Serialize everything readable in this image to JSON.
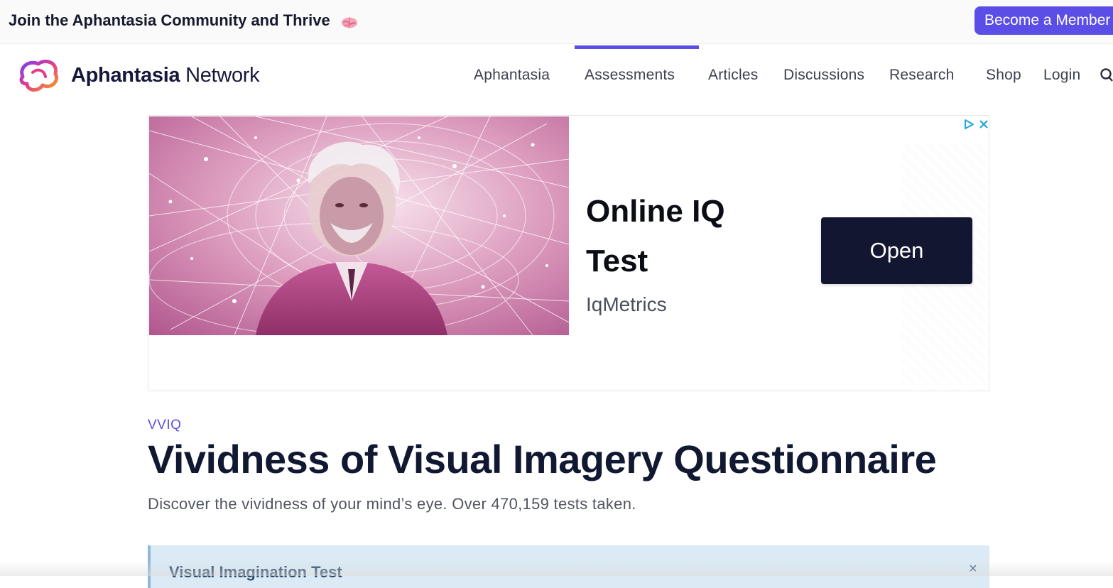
{
  "announcement": {
    "text": "Join the Aphantasia Community and Thrive",
    "emoji_icon": "brain-icon",
    "cta_label": "Become a Member"
  },
  "header": {
    "logo_bold": "Aphantasia",
    "logo_regular": " Network",
    "nav": [
      {
        "label": "Aphantasia",
        "active": false
      },
      {
        "label": "Assessments",
        "active": true
      },
      {
        "label": "Articles",
        "active": false
      },
      {
        "label": "Discussions",
        "active": false
      },
      {
        "label": "Research",
        "active": false
      },
      {
        "label": "Shop",
        "active": false
      },
      {
        "label": "Login",
        "active": false
      }
    ],
    "search_icon": "search-icon"
  },
  "ad": {
    "headline": "Online IQ Test",
    "advertiser": "IqMetrics",
    "button_label": "Open",
    "image_icon": "einstein-portrait-image"
  },
  "page": {
    "eyebrow": "VVIQ",
    "title": "Vividness of Visual Imagery Questionnaire",
    "subtitle": "Discover the vividness of your mind’s eye. Over 470,159 tests taken."
  },
  "notice": {
    "title": "Visual Imagination Test",
    "close_glyph": "×"
  },
  "colors": {
    "accent": "#5b4ee6",
    "ad_button": "#121631",
    "notice_bg": "#dbeaf5"
  }
}
